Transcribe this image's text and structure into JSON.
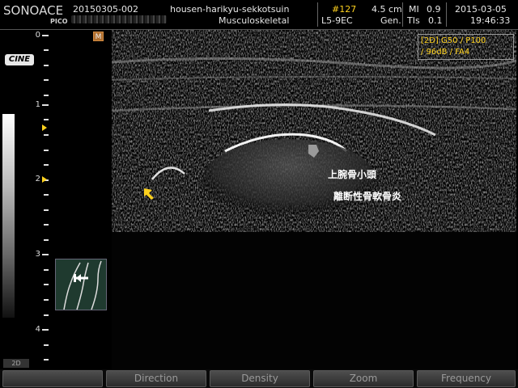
{
  "header": {
    "brand": "SONOACE",
    "brand_sub": "PICO",
    "patient_id": "20150305-002",
    "institution": "housen-harikyu-sekkotsuin",
    "preset": "Musculoskeletal",
    "frame": "#127",
    "depth": "4.5 cm",
    "probe": "L5-9EC",
    "mi_label": "MI",
    "mi_value": "0.9",
    "gen": "Gen.",
    "tis_label": "TIs",
    "tis_value": "0.1",
    "date": "2015-03-05",
    "time": "19:46:33"
  },
  "cine_label": "CINE",
  "orientation_marker": "M",
  "mode_tag": "2D",
  "settings": {
    "line1": "[2D] G50 / P100",
    "line2": "/ 96dB / FA4"
  },
  "depth_scale": [
    "0",
    "1",
    "2",
    "3",
    "4"
  ],
  "annotations": {
    "line1": "上腕骨小頭",
    "line2": "離断性骨軟骨炎"
  },
  "softkeys": [
    "",
    "Direction",
    "Density",
    "Zoom",
    "Frequency"
  ],
  "colors": {
    "accent": "#ffd21e",
    "text": "#e6e6e6",
    "softkey_text": "#9a9a9a"
  },
  "icons": {
    "pointer": "arrow-pointer-icon",
    "probe": "probe-position-icon"
  }
}
